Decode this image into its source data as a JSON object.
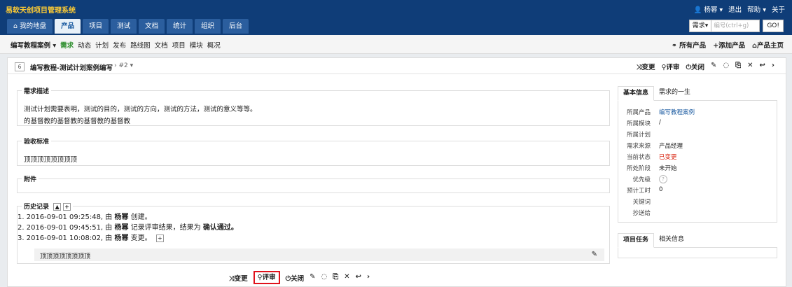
{
  "app": {
    "title": "易软天创项目管理系统"
  },
  "user_menu": {
    "user": "杨幂",
    "logout": "退出",
    "help": "帮助",
    "about": "关于"
  },
  "nav_tabs": [
    "我的地盘",
    "产品",
    "项目",
    "测试",
    "文档",
    "统计",
    "组织",
    "后台"
  ],
  "search": {
    "type": "需求",
    "placeholder": "编号(ctrl+g)",
    "go": "GO!"
  },
  "subnav": {
    "product": "编写教程案例",
    "items": [
      "需求",
      "动态",
      "计划",
      "发布",
      "路线图",
      "文档",
      "项目",
      "模块",
      "概况"
    ],
    "right": [
      "所有产品",
      "添加产品",
      "产品主页"
    ]
  },
  "story": {
    "id": "6",
    "title": "编写教程-测试计划案例编写",
    "version": "#2"
  },
  "actions": [
    "变更",
    "评审",
    "关闭"
  ],
  "sections": {
    "desc_label": "需求描述",
    "desc_line1": "测试计划需要表明，测试的目的，测试的方向，测试的方法，测试的意义等等。",
    "desc_line2": "的基督教的基督教的基督教的基督教",
    "verify_label": "验收标准",
    "verify_text": "顶顶顶顶顶顶顶顶",
    "attach_label": "附件",
    "history_label": "历史记录"
  },
  "history": [
    {
      "prefix": "1. 2016-09-01 09:25:48, 由",
      "user": "杨幂",
      "action": "创建。"
    },
    {
      "prefix": "2. 2016-09-01 09:45:51, 由",
      "user": "杨幂",
      "action": "记录评审结果，结果为",
      "result": "确认通过。"
    },
    {
      "prefix": "3. 2016-09-01 10:08:02, 由",
      "user": "杨幂",
      "action": "变更。"
    }
  ],
  "history_note": "顶顶顶顶顶顶顶顶",
  "info_tabs": [
    "基本信息",
    "需求的一生"
  ],
  "info": [
    {
      "k": "所属产品",
      "v": "编写教程案例"
    },
    {
      "k": "所属模块",
      "v": "/"
    },
    {
      "k": "所属计划",
      "v": ""
    },
    {
      "k": "需求来源",
      "v": "产品经理"
    },
    {
      "k": "当前状态",
      "v": "已变更"
    },
    {
      "k": "所处阶段",
      "v": "未开始"
    },
    {
      "k": "优先级",
      "v": "?"
    },
    {
      "k": "预计工时",
      "v": "0"
    },
    {
      "k": "关键词",
      "v": ""
    },
    {
      "k": "抄送给",
      "v": ""
    }
  ],
  "task_tabs": [
    "项目任务",
    "相关信息"
  ],
  "colors": {
    "topbar": "#0f3d78",
    "brand": "#ffcc33",
    "link": "#1a5aa0",
    "status_changed": "#d9230f",
    "highlight": "#e0111b"
  }
}
